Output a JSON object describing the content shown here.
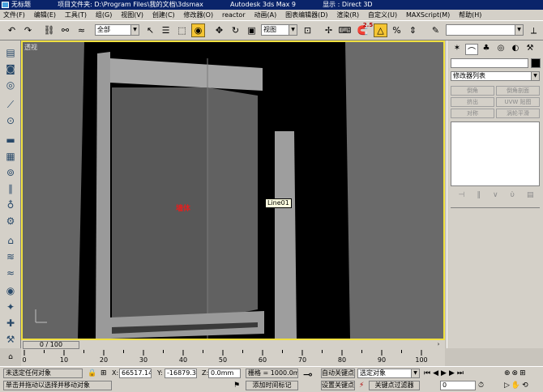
{
  "window": {
    "title": "无标题",
    "project_label": "项目文件夹:",
    "project_path": "D:\\Program Files\\我的文档\\3dsmax",
    "app_name": "Autodesk 3ds Max 9",
    "display_label": "显示 : Direct 3D"
  },
  "menu": [
    "文件(F)",
    "编辑(E)",
    "工具(T)",
    "组(G)",
    "视图(V)",
    "创建(C)",
    "修改器(O)",
    "reactor",
    "动画(A)",
    "图表编辑器(D)",
    "渲染(R)",
    "自定义(U)",
    "MAXScript(M)",
    "帮助(H)"
  ],
  "toolbar": {
    "selection_filter": "全部",
    "ref_coord": "视图",
    "snap_value": "2.5",
    "named_sel_placeholder": ""
  },
  "viewport": {
    "label": "透视",
    "object_label_red": "墙体",
    "object_label_tag": "Line01",
    "border_color": "#f0e040",
    "bg_color": "#000000"
  },
  "modify_panel": {
    "modifier_list": "修改器列表",
    "buttons": [
      "倒角",
      "倒角剖面",
      "挤出",
      "UVW 贴图",
      "对称",
      "涡轮平滑"
    ]
  },
  "timeline": {
    "frame_display": "0 / 100",
    "ticks": [
      "0",
      "10",
      "20",
      "30",
      "40",
      "50",
      "60",
      "70",
      "80",
      "90",
      "100"
    ],
    "progress": 0
  },
  "status": {
    "selection": "未选定任何对象",
    "prompt": "单击并拖动以选择并移动对象",
    "x_label": "X:",
    "x_value": "66517.141",
    "y_label": "Y:",
    "y_value": "-16879.32",
    "z_label": "Z:",
    "z_value": "0.0mm",
    "grid": "栅格 = 1000.0mm",
    "add_time_tag": "添加时间标记",
    "auto_key": "自动关键点",
    "set_key": "设置关键点",
    "key_mode": "选定对象",
    "key_filters": "关键点过滤器",
    "current_frame": "0"
  }
}
